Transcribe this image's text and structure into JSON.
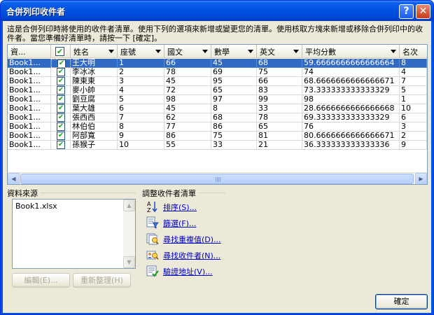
{
  "window": {
    "title": "合併列印收件者",
    "help_glyph": "?",
    "close_glyph": "✕"
  },
  "description": "這是合併列印時將使用的收件者清單。使用下列的選項來新增或變更您的清單。使用核取方塊來新增或移除合併列印中的收件者。當您準備好清單時，請按一下 [確定]。",
  "grid": {
    "columns": [
      "資...",
      "",
      "姓名",
      "座號",
      "國文",
      "數學",
      "英文",
      "平均分數",
      "名次"
    ],
    "checkmark": "✔",
    "rows": [
      [
        "Book1...",
        "王大明",
        "1",
        "66",
        "45",
        "68",
        "59.6666666666666664",
        "8"
      ],
      [
        "Book1...",
        "李冰冰",
        "2",
        "78",
        "69",
        "75",
        "74",
        "4"
      ],
      [
        "Book1...",
        "陳東東",
        "3",
        "45",
        "95",
        "66",
        "68.6666666666666671",
        "7"
      ],
      [
        "Book1...",
        "麥小帥",
        "4",
        "72",
        "65",
        "83",
        "73.333333333333329",
        "5"
      ],
      [
        "Book1...",
        "劉豆腐",
        "5",
        "98",
        "97",
        "99",
        "98",
        "1"
      ],
      [
        "Book1...",
        "葉大雄",
        "6",
        "45",
        "8",
        "33",
        "28.6666666666666668",
        "10"
      ],
      [
        "Book1...",
        "張西西",
        "7",
        "62",
        "68",
        "78",
        "69.333333333333329",
        "6"
      ],
      [
        "Book1...",
        "林伯伯",
        "8",
        "77",
        "86",
        "65",
        "76",
        "3"
      ],
      [
        "Book1...",
        "阿部寬",
        "9",
        "86",
        "75",
        "81",
        "80.6666666666666671",
        "2"
      ],
      [
        "Book1...",
        "孫猴子",
        "10",
        "55",
        "33",
        "21",
        "36.333333333333336",
        "9"
      ]
    ]
  },
  "data_source": {
    "label": "資料來源",
    "items": [
      "Book1.xlsx"
    ],
    "edit_label": "編輯(E)...",
    "refresh_label": "重新整理(H)"
  },
  "refine": {
    "label": "調整收件者清單",
    "actions": [
      {
        "label": "排序(S)...",
        "icon": "sort-icon"
      },
      {
        "label": "篩選(F)...",
        "icon": "filter-icon"
      },
      {
        "label": "尋找重複值(D)...",
        "icon": "find-duplicates-icon"
      },
      {
        "label": "尋找收件者(N)...",
        "icon": "find-recipient-icon"
      },
      {
        "label": "驗證地址(V)...",
        "icon": "validate-addresses-icon"
      }
    ]
  },
  "ok_label": "確定"
}
